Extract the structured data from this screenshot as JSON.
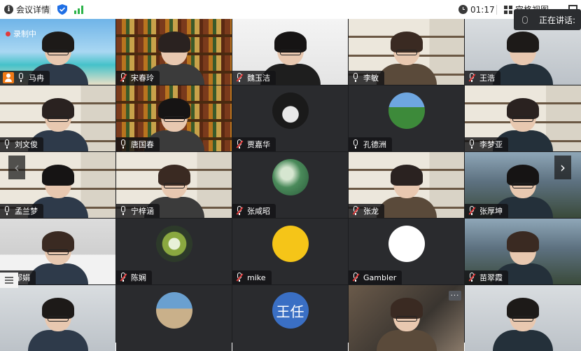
{
  "topbar": {
    "meeting_info_label": "会议详情",
    "time": "01:17",
    "view_label": "宫格视图"
  },
  "speaking_label": "正在讲话:",
  "recording_label": "录制中",
  "nav": {
    "prev": "‹",
    "next": "›"
  },
  "more_label": "···",
  "participants": [
    {
      "name": "马冉",
      "mic": "on",
      "host": true,
      "bg": "beach"
    },
    {
      "name": "宋春玲",
      "mic": "muted",
      "bg": "shelf-dark"
    },
    {
      "name": "魏玉洁",
      "mic": "muted",
      "bg": "white-wall"
    },
    {
      "name": "李敏",
      "mic": "on",
      "bg": "shelf"
    },
    {
      "name": "王浩",
      "mic": "muted",
      "bg": "bright"
    },
    {
      "name": "刘文俊",
      "mic": "on",
      "bg": "shelf"
    },
    {
      "name": "唐国春",
      "mic": "on",
      "bg": "shelf-dark"
    },
    {
      "name": "贾嘉华",
      "mic": "muted",
      "avatar": "hat"
    },
    {
      "name": "孔德洲",
      "mic": "on",
      "avatar": "field"
    },
    {
      "name": "李梦亚",
      "mic": "on",
      "bg": "shelf"
    },
    {
      "name": "孟兰梦",
      "mic": "on",
      "bg": "shelf"
    },
    {
      "name": "宁梓涵",
      "mic": "on",
      "bg": "shelf"
    },
    {
      "name": "张咸昭",
      "mic": "muted",
      "avatar": "forest"
    },
    {
      "name": "张龙",
      "mic": "muted",
      "bg": "shelf"
    },
    {
      "name": "张厚坤",
      "mic": "muted",
      "bg": "building"
    },
    {
      "name": "邹娟",
      "mic": "muted",
      "bg": "office"
    },
    {
      "name": "陈娴",
      "mic": "muted",
      "avatar": "flower"
    },
    {
      "name": "mike",
      "mic": "muted",
      "avatar": "monkey"
    },
    {
      "name": "Gambler",
      "mic": "muted",
      "avatar": "dino"
    },
    {
      "name": "苗翠霞",
      "mic": "muted",
      "bg": "building"
    },
    {
      "name": "",
      "bg": "bright"
    },
    {
      "name": "",
      "avatar": "person"
    },
    {
      "name": "",
      "avatar_text": "王任"
    },
    {
      "name": "",
      "bg": "blur"
    },
    {
      "name": "",
      "bg": "bright"
    }
  ]
}
